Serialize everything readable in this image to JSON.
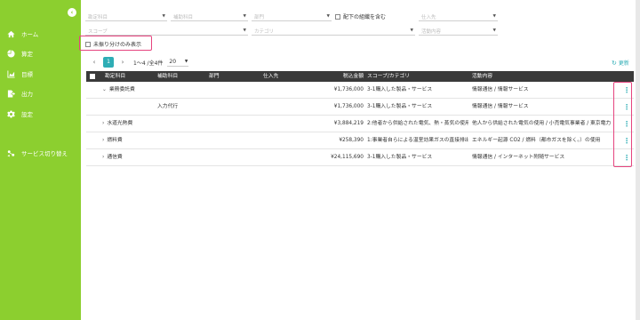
{
  "sidebar": {
    "collapse_icon": "chevron-left-icon",
    "items": [
      {
        "label": "ホーム",
        "icon": "home-icon"
      },
      {
        "label": "算定",
        "icon": "chart-pie-icon"
      },
      {
        "label": "目標",
        "icon": "chart-area-icon"
      },
      {
        "label": "出力",
        "icon": "file-export-icon"
      },
      {
        "label": "設定",
        "icon": "gear-icon"
      },
      {
        "label": "サービス切り替え",
        "icon": "switch-icon"
      }
    ]
  },
  "filters": {
    "account": "勘定科目",
    "sub_account": "補助科目",
    "department": "部門",
    "include_sub_org": "配下の組織を含む",
    "supplier": "仕入先",
    "scope": "スコープ",
    "category": "カテゴリ",
    "activity": "活動内容",
    "unassigned_only": "未振り分けのみ表示"
  },
  "pager": {
    "current_page": "1",
    "info": "1〜4 /全4件",
    "page_size": "20",
    "refresh": "更新"
  },
  "table": {
    "headers": {
      "account": "勘定科目",
      "sub_account": "補助科目",
      "department": "部門",
      "supplier": "仕入先",
      "amount": "税込金額",
      "scope": "スコープ/カテゴリ",
      "activity": "活動内容"
    },
    "rows": [
      {
        "account": "業務委託費",
        "expanded": true,
        "sub_account": "",
        "amount": "¥1,736,000",
        "scope": "3-1購入した製品・サービス",
        "activity": "情報通信 / 情報サービス"
      },
      {
        "account": "",
        "expanded": false,
        "sub_account": "入力代行",
        "amount": "¥1,736,000",
        "scope": "3-1購入した製品・サービス",
        "activity": "情報通信 / 情報サービス"
      },
      {
        "account": "水道光熱費",
        "expanded": false,
        "sub_account": "",
        "amount": "¥3,884,219",
        "scope": "2:他者から供給された電気、熱・蒸気の使用",
        "activity": "他人から供給された電気の使用 / 小売電気事業者 / 東京電力"
      },
      {
        "account": "燃料費",
        "expanded": false,
        "sub_account": "",
        "amount": "¥258,390",
        "scope": "1:事業者自らによる温室効果ガスの直接排出",
        "activity": "エネルギー起源 CO2 / 燃料（都市ガスを除く。）の使用"
      },
      {
        "account": "通信費",
        "expanded": false,
        "sub_account": "",
        "amount": "¥24,115,690",
        "scope": "3-1購入した製品・サービス",
        "activity": "情報通信 / インターネット附随サービス"
      }
    ]
  },
  "colors": {
    "sidebar": "#8ccf2f",
    "accent": "#2eadb5",
    "highlight": "#e6447f",
    "header": "#3a3a3a"
  }
}
